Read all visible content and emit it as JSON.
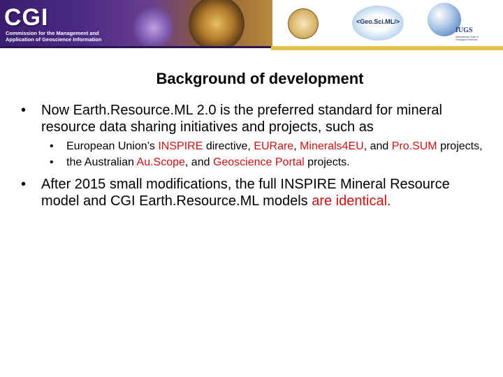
{
  "header": {
    "logo_text": "CGI",
    "logo_subtitle": "Commission for the Management and Application of Geoscience Information",
    "geosciml_logo": "<Geo.Sci.ML/>",
    "iugs_logo": "IUGS",
    "iugs_sub": "International Union of Geological Sciences"
  },
  "slide": {
    "title": "Background of development",
    "bullets": [
      {
        "level": 1,
        "parts": [
          "Now Earth.Resource.ML 2.0 is the preferred standard for mineral resource data sharing initiatives and projects, such as"
        ]
      },
      {
        "level": 2,
        "parts": [
          "European Union’s ",
          "INSPIRE",
          " directive, ",
          "EURare",
          ", ",
          "Minerals4EU",
          ", and ",
          "Pro.SUM",
          " projects,"
        ]
      },
      {
        "level": 2,
        "parts": [
          "the Australian ",
          "Au.Scope",
          ", and ",
          "Geoscience Portal",
          " projects."
        ]
      },
      {
        "level": 1,
        "parts": [
          "After 2015 small modifications, the full INSPIRE Mineral Resource model and CGI Earth.Resource.ML models ",
          "are identical."
        ]
      }
    ]
  },
  "colors": {
    "accent_red": "#cc1111",
    "banner_purple": "#4b2a86",
    "banner_gold": "#e8c14a"
  }
}
